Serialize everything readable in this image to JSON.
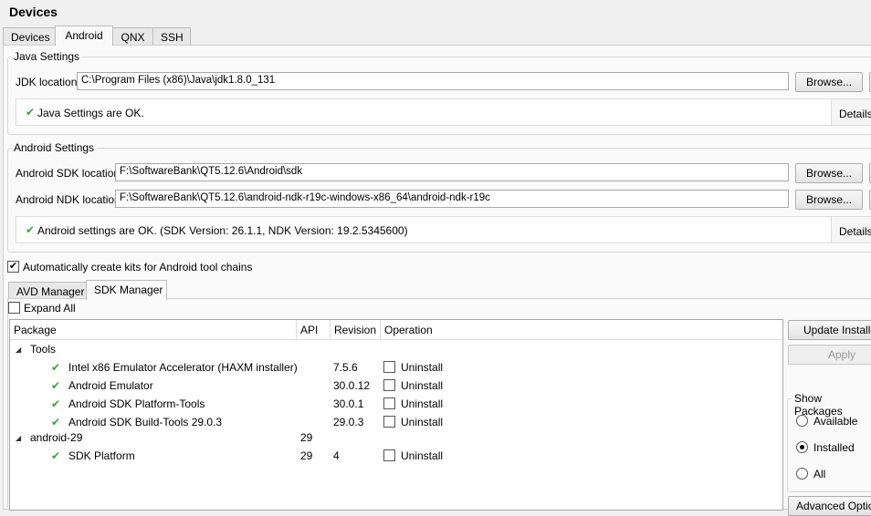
{
  "window": {
    "title": "Devices"
  },
  "top_tabs": [
    "Devices",
    "Android",
    "QNX",
    "SSH"
  ],
  "java": {
    "group_title": "Java Settings",
    "jdk_label": "JDK location:",
    "jdk_value": "C:\\Program Files (x86)\\Java\\jdk1.8.0_131",
    "browse": "Browse...",
    "status": "Java Settings are OK.",
    "details": "Details"
  },
  "android": {
    "group_title": "Android Settings",
    "sdk_label": "Android SDK location:",
    "sdk_value": "F:\\SoftwareBank\\QT5.12.6\\Android\\sdk",
    "ndk_label": "Android NDK location:",
    "ndk_value": "F:\\SoftwareBank\\QT5.12.6\\android-ndk-r19c-windows-x86_64\\android-ndk-r19c",
    "browse": "Browse...",
    "status": "Android settings are OK. (SDK Version: 26.1.1, NDK Version: 19.2.5345600)",
    "details": "Details"
  },
  "auto_kits": {
    "label": "Automatically create kits for Android tool chains",
    "checked": true
  },
  "sub_tabs": [
    "AVD Manager",
    "SDK Manager"
  ],
  "sdk_manager": {
    "expand_all": "Expand All",
    "columns": [
      "Package",
      "API",
      "Revision",
      "Operation"
    ],
    "tools_label": "Tools",
    "tools": [
      {
        "name": "Intel x86 Emulator Accelerator (HAXM installer)",
        "api": "",
        "revision": "7.5.6",
        "op": "Uninstall"
      },
      {
        "name": "Android Emulator",
        "api": "",
        "revision": "30.0.12",
        "op": "Uninstall"
      },
      {
        "name": "Android SDK Platform-Tools",
        "api": "",
        "revision": "30.0.1",
        "op": "Uninstall"
      },
      {
        "name": "Android SDK Build-Tools 29.0.3",
        "api": "",
        "revision": "29.0.3",
        "op": "Uninstall"
      }
    ],
    "platform_label": "android-29",
    "platform_api": "29",
    "platform_items": [
      {
        "name": "SDK Platform",
        "api": "29",
        "revision": "4",
        "op": "Uninstall"
      }
    ],
    "update_button": "Update Installe",
    "apply_button": "Apply",
    "show_packages": "Show Packages",
    "radio_available": "Available",
    "radio_installed": "Installed",
    "radio_all": "All",
    "selected_filter": "Installed",
    "advanced_button": "Advanced Options"
  }
}
